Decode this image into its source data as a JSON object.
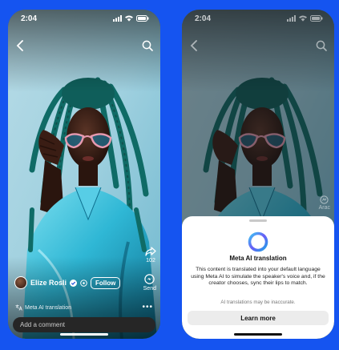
{
  "status": {
    "time": "2:04"
  },
  "reel": {
    "share_count": "102",
    "send_label": "Send",
    "creator_name": "Elize Rosli",
    "follow_label": "Follow",
    "ai_translation_label": "Meta AI translation",
    "more_icon": "•••",
    "comment_placeholder": "Add a comment"
  },
  "right_phone": {
    "faded_label": "Arac"
  },
  "sheet": {
    "title": "Meta AI translation",
    "body": "This content is translated into your default language using Meta AI to simulate the speaker's voice and, if the creator chooses, sync their lips to match.",
    "note": "AI translations may be inaccurate.",
    "learn_more_label": "Learn more"
  },
  "colors": {
    "background": "#1554f0",
    "sheet": "#ffffff",
    "button": "#ececec"
  },
  "icons": [
    "back-arrow-icon",
    "search-icon",
    "share-icon",
    "send-icon",
    "verified-icon",
    "translate-icon",
    "meta-ai-ring-icon",
    "wifi-icon",
    "signal-icon",
    "battery-icon"
  ]
}
